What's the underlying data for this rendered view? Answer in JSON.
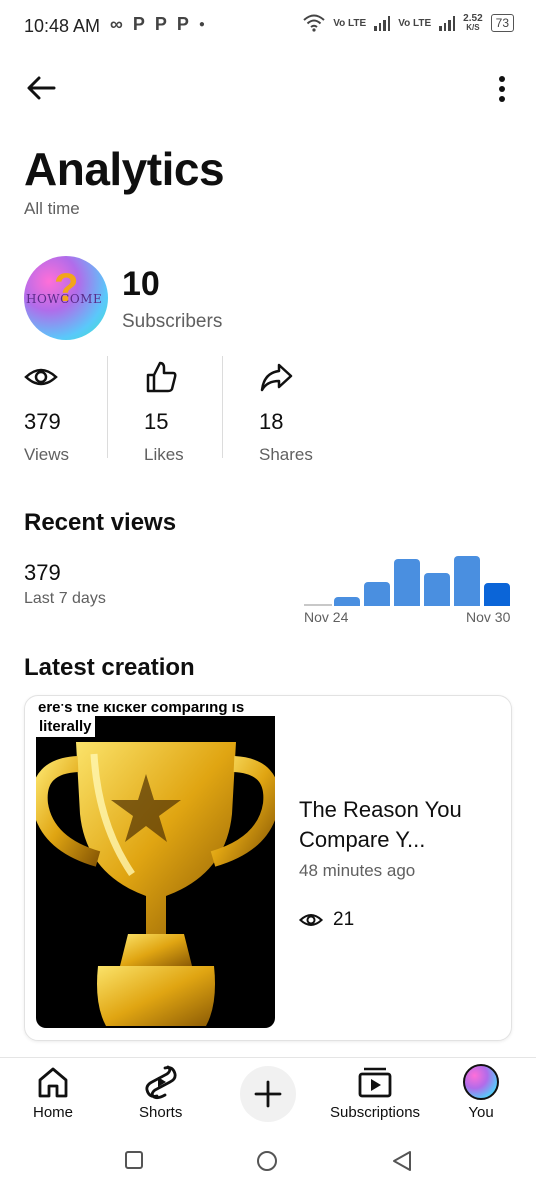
{
  "status_bar": {
    "time": "10:48 AM",
    "left_icons": [
      "infinity-icon",
      "p-icon",
      "p-icon",
      "p-icon",
      "dot-icon"
    ],
    "net_speed_value": "2.52",
    "net_speed_unit": "K/S",
    "battery": "73",
    "volte1": "Vo LTE",
    "volte2": "Vo LTE"
  },
  "header": {
    "back_icon": "arrow-left-icon",
    "more_icon": "more-vert-icon",
    "title": "Analytics",
    "subtitle": "All time"
  },
  "channel": {
    "avatar_text": "HOWCOME",
    "subscribers_count": "10",
    "subscribers_label": "Subscribers"
  },
  "stats": [
    {
      "icon": "eye-icon",
      "value": "379",
      "label": "Views"
    },
    {
      "icon": "thumbs-up-icon",
      "value": "15",
      "label": "Likes"
    },
    {
      "icon": "share-icon",
      "value": "18",
      "label": "Shares"
    }
  ],
  "recent_views": {
    "title": "Recent views",
    "value": "379",
    "period": "Last 7 days"
  },
  "chart_data": {
    "type": "bar",
    "categories": [
      "Nov 24",
      "Nov 25",
      "Nov 26",
      "Nov 27",
      "Nov 28",
      "Nov 29",
      "Nov 30"
    ],
    "values": [
      0,
      18,
      48,
      92,
      64,
      98,
      46
    ],
    "x_tick_labels": [
      "Nov 24",
      "Nov 30"
    ],
    "colors": {
      "bar": "#4a8fe0",
      "highlight": "#0b65d8"
    },
    "grid": false
  },
  "latest_creation": {
    "title": "Latest creation",
    "thumb_caption_line1": "ere's the kicker comparing is",
    "thumb_caption_line2": "literally",
    "video_title": "The Reason You Compare Y...",
    "time_ago": "48 minutes ago",
    "views": "21"
  },
  "bottom_nav": [
    {
      "icon": "home-icon",
      "label": "Home"
    },
    {
      "icon": "shorts-icon",
      "label": "Shorts"
    },
    {
      "icon": "plus-icon",
      "label": ""
    },
    {
      "icon": "subscriptions-icon",
      "label": "Subscriptions"
    },
    {
      "icon": "avatar-icon",
      "label": "You"
    }
  ],
  "system_nav": [
    "square-icon",
    "circle-icon",
    "triangle-back-icon"
  ]
}
